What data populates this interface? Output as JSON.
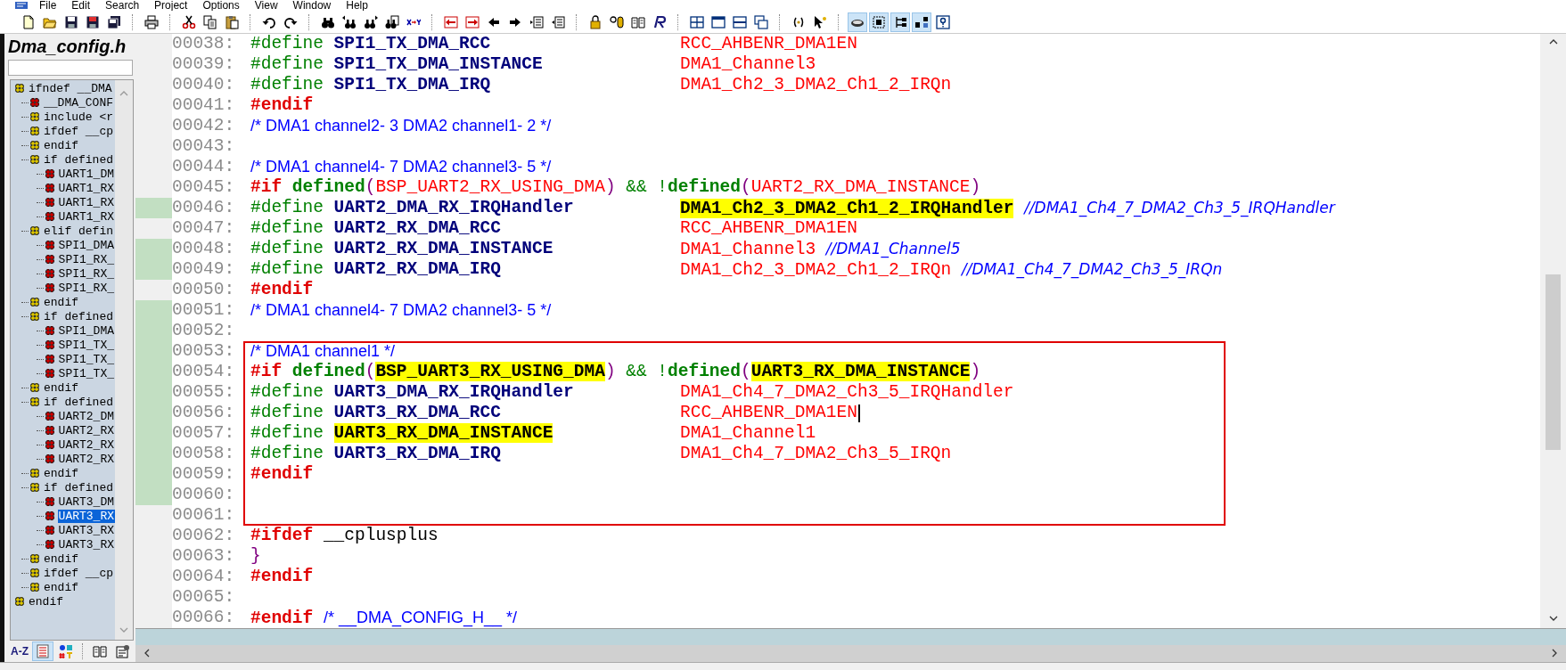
{
  "menu": [
    "File",
    "Edit",
    "Search",
    "Project",
    "Options",
    "View",
    "Window",
    "Help"
  ],
  "toolbar": [
    [
      {
        "kind": "new",
        "pressed": false
      },
      {
        "kind": "open",
        "pressed": false
      },
      {
        "kind": "save",
        "pressed": false
      },
      {
        "kind": "savered",
        "pressed": false
      },
      {
        "kind": "saveall",
        "pressed": false
      }
    ],
    [
      {
        "kind": "print",
        "pressed": false
      }
    ],
    [
      {
        "kind": "cut",
        "pressed": false
      },
      {
        "kind": "copy",
        "pressed": false
      },
      {
        "kind": "paste",
        "pressed": false
      }
    ],
    [
      {
        "kind": "undo",
        "pressed": false
      },
      {
        "kind": "redo",
        "pressed": false
      }
    ],
    [
      {
        "kind": "find",
        "pressed": false
      },
      {
        "kind": "findprev",
        "pressed": false
      },
      {
        "kind": "findnext",
        "pressed": false
      },
      {
        "kind": "findfiles",
        "pressed": false
      },
      {
        "kind": "replace",
        "pressed": false
      }
    ],
    [
      {
        "kind": "markprev",
        "pressed": false
      },
      {
        "kind": "marknext",
        "pressed": false
      },
      {
        "kind": "back",
        "pressed": false
      },
      {
        "kind": "forward",
        "pressed": false
      },
      {
        "kind": "jumpin",
        "pressed": false
      },
      {
        "kind": "jumpout",
        "pressed": false
      }
    ],
    [
      {
        "kind": "lock",
        "pressed": false
      },
      {
        "kind": "symbol",
        "pressed": false
      },
      {
        "kind": "book",
        "pressed": false
      },
      {
        "kind": "regex",
        "pressed": false
      }
    ],
    [
      {
        "kind": "tile",
        "pressed": false
      },
      {
        "kind": "panel",
        "pressed": false
      },
      {
        "kind": "split",
        "pressed": false
      },
      {
        "kind": "cascade",
        "pressed": false
      }
    ],
    [
      {
        "kind": "calltip",
        "pressed": false
      },
      {
        "kind": "pointer",
        "pressed": false
      }
    ],
    [
      {
        "kind": "eye",
        "pressed": true
      },
      {
        "kind": "frame",
        "pressed": true
      },
      {
        "kind": "tree",
        "pressed": true
      },
      {
        "kind": "hier",
        "pressed": true
      },
      {
        "kind": "help",
        "pressed": false
      }
    ]
  ],
  "sidebar": {
    "title": "Dma_config.h",
    "tree": [
      {
        "label": "ifndef __DMA",
        "kind": "conditional",
        "selected": false,
        "children": [
          {
            "label": "__DMA_CONF",
            "kind": "define",
            "selected": false
          },
          {
            "label": "include <r",
            "kind": "conditional",
            "selected": false
          },
          {
            "label": "ifdef __cp",
            "kind": "conditional",
            "selected": false
          },
          {
            "label": "endif",
            "kind": "conditional",
            "selected": false
          },
          {
            "label": "if defined",
            "kind": "conditional",
            "selected": false,
            "children": [
              {
                "label": "UART1_DM",
                "kind": "define",
                "selected": false
              },
              {
                "label": "UART1_RX",
                "kind": "define",
                "selected": false
              },
              {
                "label": "UART1_RX",
                "kind": "define",
                "selected": false
              },
              {
                "label": "UART1_RX",
                "kind": "define",
                "selected": false
              }
            ]
          },
          {
            "label": "elif defin",
            "kind": "conditional",
            "selected": false,
            "children": [
              {
                "label": "SPI1_DMA",
                "kind": "define",
                "selected": false
              },
              {
                "label": "SPI1_RX_",
                "kind": "define",
                "selected": false
              },
              {
                "label": "SPI1_RX_",
                "kind": "define",
                "selected": false
              },
              {
                "label": "SPI1_RX_",
                "kind": "define",
                "selected": false
              }
            ]
          },
          {
            "label": "endif",
            "kind": "conditional",
            "selected": false
          },
          {
            "label": "if defined",
            "kind": "conditional",
            "selected": false,
            "children": [
              {
                "label": "SPI1_DMA",
                "kind": "define",
                "selected": false
              },
              {
                "label": "SPI1_TX_",
                "kind": "define",
                "selected": false
              },
              {
                "label": "SPI1_TX_",
                "kind": "define",
                "selected": false
              },
              {
                "label": "SPI1_TX_",
                "kind": "define",
                "selected": false
              }
            ]
          },
          {
            "label": "endif",
            "kind": "conditional",
            "selected": false
          },
          {
            "label": "if defined",
            "kind": "conditional",
            "selected": false,
            "children": [
              {
                "label": "UART2_DM",
                "kind": "define",
                "selected": false
              },
              {
                "label": "UART2_RX",
                "kind": "define",
                "selected": false
              },
              {
                "label": "UART2_RX",
                "kind": "define",
                "selected": false
              },
              {
                "label": "UART2_RX",
                "kind": "define",
                "selected": false
              }
            ]
          },
          {
            "label": "endif",
            "kind": "conditional",
            "selected": false
          },
          {
            "label": "if defined",
            "kind": "conditional",
            "selected": false,
            "children": [
              {
                "label": "UART3_DM",
                "kind": "define",
                "selected": false
              },
              {
                "label": "UART3_RX",
                "kind": "define",
                "selected": true
              },
              {
                "label": "UART3_RX",
                "kind": "define",
                "selected": false
              },
              {
                "label": "UART3_RX",
                "kind": "define",
                "selected": false
              }
            ]
          },
          {
            "label": "endif",
            "kind": "conditional",
            "selected": false
          },
          {
            "label": "ifdef __cp",
            "kind": "conditional",
            "selected": false
          },
          {
            "label": "endif",
            "kind": "conditional",
            "selected": false
          }
        ]
      },
      {
        "label": "endif",
        "kind": "conditional",
        "selected": false
      }
    ],
    "tools": [
      [
        {
          "kind": "sort",
          "label": "A-Z",
          "pressed": false
        },
        {
          "kind": "list",
          "pressed": true
        },
        {
          "kind": "symbols",
          "pressed": false
        }
      ],
      [
        {
          "kind": "book",
          "pressed": false
        },
        {
          "kind": "props",
          "pressed": false
        }
      ]
    ]
  },
  "editor": {
    "blocks": [
      {
        "boxed": false,
        "lines": [
          {
            "number": "00038:",
            "modified": false,
            "caret": false,
            "code": [
              [
                {
                  "text": "#define",
                  "kind": "define"
                }
              ],
              [
                {
                  "text": "SPI1_TX_DMA_RCC",
                  "kind": "name"
                }
              ]
            ],
            "value": [
              [
                {
                  "text": "RCC_AHBENR_DMA1EN",
                  "kind": "value"
                }
              ]
            ]
          },
          {
            "number": "00039:",
            "modified": false,
            "caret": false,
            "code": [
              [
                {
                  "text": "#define",
                  "kind": "define"
                }
              ],
              [
                {
                  "text": "SPI1_TX_DMA_INSTANCE",
                  "kind": "name"
                }
              ]
            ],
            "value": [
              [
                {
                  "text": "DMA1_Channel3",
                  "kind": "value"
                }
              ]
            ]
          },
          {
            "number": "00040:",
            "modified": false,
            "caret": false,
            "code": [
              [
                {
                  "text": "#define",
                  "kind": "define"
                }
              ],
              [
                {
                  "text": "SPI1_TX_DMA_IRQ",
                  "kind": "name"
                }
              ]
            ],
            "value": [
              [
                {
                  "text": "DMA1_Ch2_3_DMA2_Ch1_2_IRQn",
                  "kind": "value"
                }
              ]
            ]
          },
          {
            "number": "00041:",
            "modified": false,
            "caret": false,
            "code": [
              [
                {
                  "text": "#endif",
                  "kind": "keyword"
                }
              ]
            ]
          },
          {
            "number": "00042:",
            "modified": false,
            "caret": false,
            "code": [
              [
                {
                  "text": "/* DMA1 channel2- 3 DMA2 channel1- 2 */",
                  "kind": "comment"
                }
              ]
            ]
          },
          {
            "number": "00043:",
            "modified": false,
            "caret": false
          },
          {
            "number": "00044:",
            "modified": false,
            "caret": false,
            "code": [
              [
                {
                  "text": "/* DMA1 channel4- 7 DMA2 channel3- 5 */",
                  "kind": "comment"
                }
              ]
            ]
          },
          {
            "number": "00045:",
            "modified": false,
            "caret": false,
            "code": [
              [
                {
                  "text": "#if",
                  "kind": "keyword"
                }
              ],
              [
                {
                  "text": "defined",
                  "kind": "defined"
                },
                {
                  "text": "(",
                  "kind": "paren"
                },
                {
                  "text": "BSP_UART2_RX_USING_DMA",
                  "kind": "value"
                },
                {
                  "text": ")",
                  "kind": "paren"
                }
              ],
              [
                {
                  "text": "&&",
                  "kind": "operator"
                }
              ],
              [
                {
                  "text": "!",
                  "kind": "operator"
                },
                {
                  "text": "defined",
                  "kind": "defined"
                },
                {
                  "text": "(",
                  "kind": "paren"
                },
                {
                  "text": "UART2_RX_DMA_INSTANCE",
                  "kind": "value"
                },
                {
                  "text": ")",
                  "kind": "paren"
                }
              ]
            ]
          },
          {
            "number": "00046:",
            "modified": true,
            "caret": false,
            "code": [
              [
                {
                  "text": "#define",
                  "kind": "define"
                }
              ],
              [
                {
                  "text": "UART2_DMA_RX_IRQHandler",
                  "kind": "name"
                }
              ]
            ],
            "value": [
              [
                {
                  "text": "DMA1_Ch2_3_DMA2_Ch1_2_IRQHandler",
                  "kind": "highlight"
                }
              ],
              [
                {
                  "text": "//DMA1_Ch4_7_DMA2_Ch3_5_IRQHandler",
                  "kind": "note"
                }
              ]
            ]
          },
          {
            "number": "00047:",
            "modified": false,
            "caret": false,
            "code": [
              [
                {
                  "text": "#define",
                  "kind": "define"
                }
              ],
              [
                {
                  "text": "UART2_RX_DMA_RCC",
                  "kind": "name"
                }
              ]
            ],
            "value": [
              [
                {
                  "text": "RCC_AHBENR_DMA1EN",
                  "kind": "value"
                }
              ]
            ]
          },
          {
            "number": "00048:",
            "modified": true,
            "caret": false,
            "code": [
              [
                {
                  "text": "#define",
                  "kind": "define"
                }
              ],
              [
                {
                  "text": "UART2_RX_DMA_INSTANCE",
                  "kind": "name"
                }
              ]
            ],
            "value": [
              [
                {
                  "text": "DMA1_Channel3",
                  "kind": "value"
                }
              ],
              [
                {
                  "text": "//DMA1_Channel5",
                  "kind": "note"
                }
              ]
            ]
          },
          {
            "number": "00049:",
            "modified": true,
            "caret": false,
            "code": [
              [
                {
                  "text": "#define",
                  "kind": "define"
                }
              ],
              [
                {
                  "text": "UART2_RX_DMA_IRQ",
                  "kind": "name"
                }
              ]
            ],
            "value": [
              [
                {
                  "text": "DMA1_Ch2_3_DMA2_Ch1_2_IRQn",
                  "kind": "value"
                }
              ],
              [
                {
                  "text": "//DMA1_Ch4_7_DMA2_Ch3_5_IRQn",
                  "kind": "note"
                }
              ]
            ]
          },
          {
            "number": "00050:",
            "modified": false,
            "caret": false,
            "code": [
              [
                {
                  "text": "#endif",
                  "kind": "keyword"
                }
              ]
            ]
          },
          {
            "number": "00051:",
            "modified": true,
            "caret": false,
            "code": [
              [
                {
                  "text": "/* DMA1 channel4- 7 DMA2 channel3- 5 */",
                  "kind": "comment"
                }
              ]
            ]
          },
          {
            "number": "00052:",
            "modified": true,
            "caret": false
          }
        ]
      },
      {
        "boxed": true,
        "lines": [
          {
            "number": "00053:",
            "modified": true,
            "caret": false,
            "code": [
              [
                {
                  "text": "/* DMA1 channel1 */",
                  "kind": "comment"
                }
              ]
            ]
          },
          {
            "number": "00054:",
            "modified": true,
            "caret": false,
            "code": [
              [
                {
                  "text": "#if",
                  "kind": "keyword"
                }
              ],
              [
                {
                  "text": "defined",
                  "kind": "defined"
                },
                {
                  "text": "(",
                  "kind": "paren"
                },
                {
                  "text": "BSP_UART3_RX_USING_DMA",
                  "kind": "highlight"
                },
                {
                  "text": ")",
                  "kind": "paren"
                }
              ],
              [
                {
                  "text": "&&",
                  "kind": "operator"
                }
              ],
              [
                {
                  "text": "!",
                  "kind": "operator"
                },
                {
                  "text": "defined",
                  "kind": "defined"
                },
                {
                  "text": "(",
                  "kind": "paren"
                },
                {
                  "text": "UART3_RX_DMA_INSTANCE",
                  "kind": "highlight"
                },
                {
                  "text": ")",
                  "kind": "paren"
                }
              ]
            ]
          },
          {
            "number": "00055:",
            "modified": true,
            "caret": false,
            "code": [
              [
                {
                  "text": "#define",
                  "kind": "define"
                }
              ],
              [
                {
                  "text": "UART3_DMA_RX_IRQHandler",
                  "kind": "name"
                }
              ]
            ],
            "value": [
              [
                {
                  "text": "DMA1_Ch4_7_DMA2_Ch3_5_IRQHandler",
                  "kind": "value"
                }
              ]
            ]
          },
          {
            "number": "00056:",
            "modified": true,
            "caret": true,
            "code": [
              [
                {
                  "text": "#define",
                  "kind": "define"
                }
              ],
              [
                {
                  "text": "UART3_RX_DMA_RCC",
                  "kind": "name"
                }
              ]
            ],
            "value": [
              [
                {
                  "text": "RCC_AHBENR_DMA1EN",
                  "kind": "value"
                }
              ]
            ]
          },
          {
            "number": "00057:",
            "modified": true,
            "caret": false,
            "code": [
              [
                {
                  "text": "#define",
                  "kind": "define"
                }
              ],
              [
                {
                  "text": "UART3_RX_DMA_INSTANCE",
                  "kind": "highlight"
                }
              ]
            ],
            "value": [
              [
                {
                  "text": "DMA1_Channel1",
                  "kind": "value"
                }
              ]
            ]
          },
          {
            "number": "00058:",
            "modified": true,
            "caret": false,
            "code": [
              [
                {
                  "text": "#define",
                  "kind": "define"
                }
              ],
              [
                {
                  "text": "UART3_RX_DMA_IRQ",
                  "kind": "name"
                }
              ]
            ],
            "value": [
              [
                {
                  "text": "DMA1_Ch4_7_DMA2_Ch3_5_IRQn",
                  "kind": "value"
                }
              ]
            ]
          },
          {
            "number": "00059:",
            "modified": true,
            "caret": false,
            "code": [
              [
                {
                  "text": "#endif",
                  "kind": "keyword"
                }
              ]
            ]
          },
          {
            "number": "00060:",
            "modified": true,
            "caret": false
          },
          {
            "number": "00061:",
            "modified": false,
            "caret": false
          }
        ]
      },
      {
        "boxed": false,
        "lines": [
          {
            "number": "00062:",
            "modified": false,
            "caret": false,
            "code": [
              [
                {
                  "text": "#ifdef",
                  "kind": "keyword"
                }
              ],
              [
                {
                  "text": "__cplusplus",
                  "kind": "plain"
                }
              ]
            ]
          },
          {
            "number": "00063:",
            "modified": false,
            "caret": false,
            "code": [
              [
                {
                  "text": "}",
                  "kind": "paren"
                }
              ]
            ]
          },
          {
            "number": "00064:",
            "modified": false,
            "caret": false,
            "code": [
              [
                {
                  "text": "#endif",
                  "kind": "keyword"
                }
              ]
            ]
          },
          {
            "number": "00065:",
            "modified": false,
            "caret": false
          },
          {
            "number": "00066:",
            "modified": false,
            "caret": false,
            "code": [
              [
                {
                  "text": "#endif",
                  "kind": "keyword"
                }
              ],
              [
                {
                  "text": "/* __DMA_CONFIG_H__ */",
                  "kind": "comment"
                }
              ]
            ]
          }
        ]
      }
    ]
  }
}
